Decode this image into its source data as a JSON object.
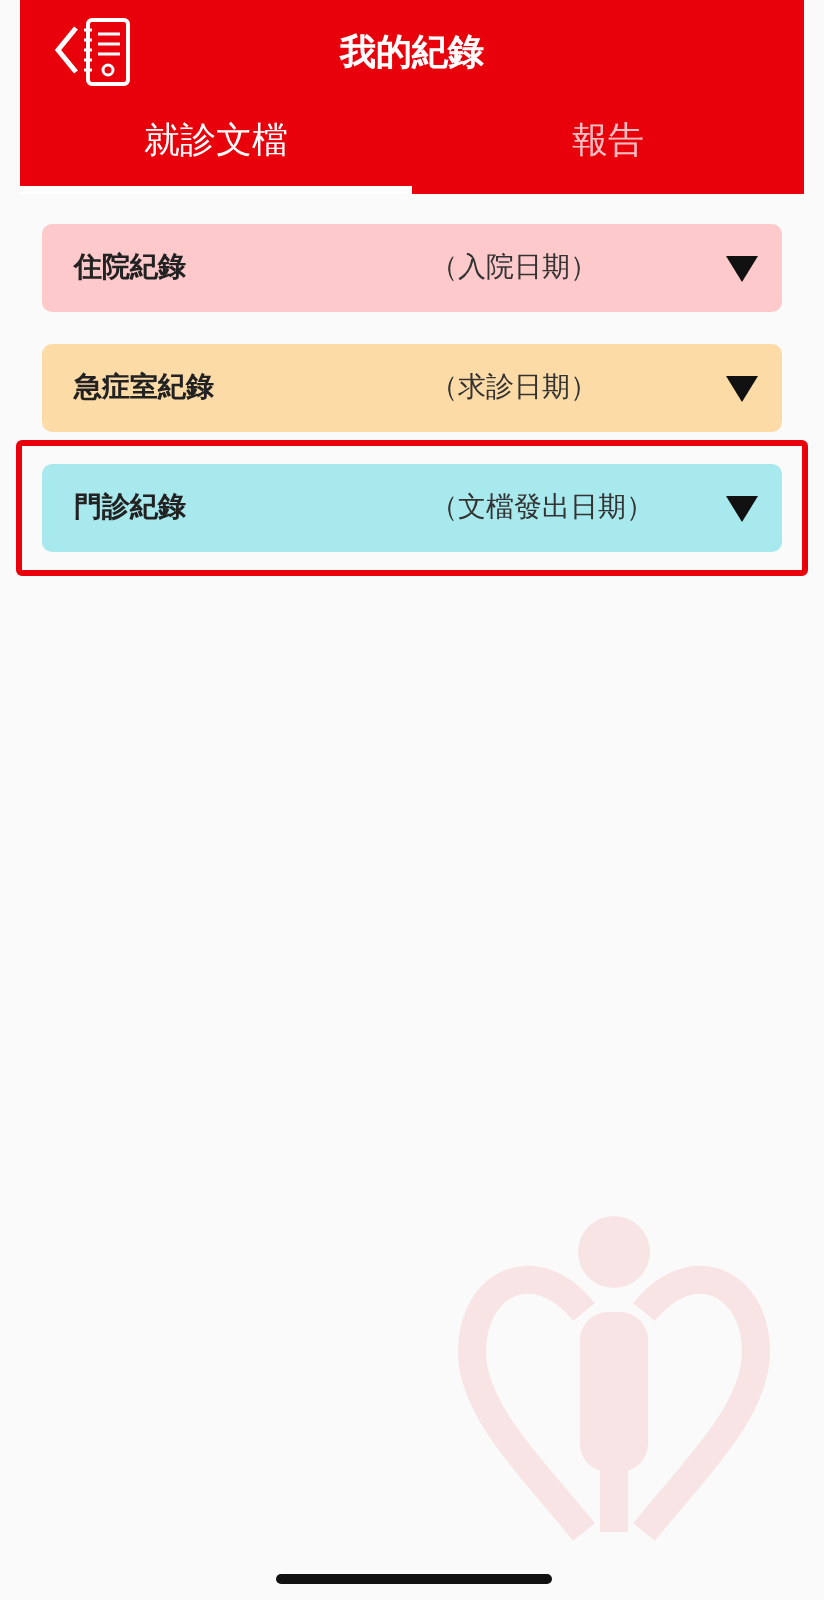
{
  "header": {
    "title": "我的紀錄"
  },
  "tabs": [
    {
      "label": "就診文檔",
      "selected": true
    },
    {
      "label": "報告",
      "selected": false
    }
  ],
  "records": [
    {
      "name": "住院紀錄",
      "date_hint": "（入院日期）",
      "color": "#fdc9cb",
      "highlighted": false
    },
    {
      "name": "急症室紀錄",
      "date_hint": "（求診日期）",
      "color": "#fddba6",
      "highlighted": false
    },
    {
      "name": "門診紀錄",
      "date_hint": "（文檔發出日期）",
      "color": "#a8e9ee",
      "highlighted": true
    }
  ]
}
